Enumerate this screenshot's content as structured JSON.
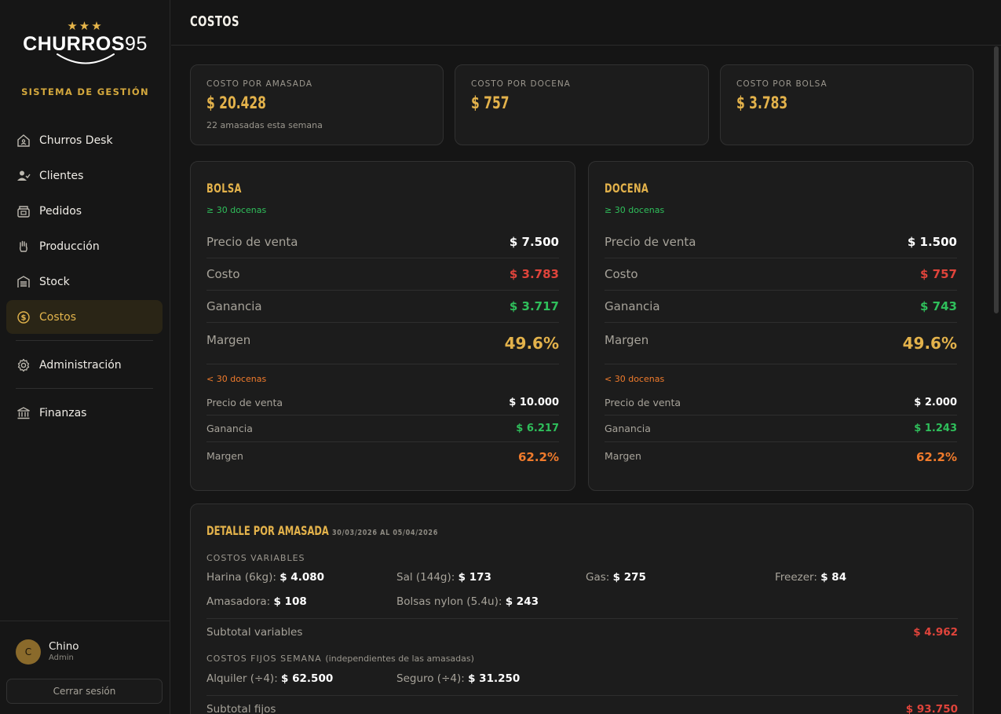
{
  "brand": {
    "stars": "★★★",
    "name": "CHURROS",
    "number": "95",
    "tagline": "SISTEMA DE GESTIÓN"
  },
  "nav": {
    "items": [
      {
        "label": "Churros Desk",
        "icon": "home-icon"
      },
      {
        "label": "Clientes",
        "icon": "user-check-icon"
      },
      {
        "label": "Pedidos",
        "icon": "box-icon"
      },
      {
        "label": "Producción",
        "icon": "hand-icon"
      },
      {
        "label": "Stock",
        "icon": "warehouse-icon"
      },
      {
        "label": "Costos",
        "icon": "dollar-circle-icon",
        "active": true
      },
      {
        "label": "Administración",
        "icon": "gear-icon"
      },
      {
        "label": "Finanzas",
        "icon": "bank-icon"
      }
    ]
  },
  "user": {
    "initial": "C",
    "name": "Chino",
    "role": "Admin",
    "logout_label": "Cerrar sesión"
  },
  "header": {
    "title": "COSTOS"
  },
  "stats": [
    {
      "label": "COSTO POR AMASADA",
      "value": "$ 20.428",
      "sub": "22 amasadas esta semana"
    },
    {
      "label": "COSTO POR DOCENA",
      "value": "$ 757"
    },
    {
      "label": "COSTO POR BOLSA",
      "value": "$ 3.783"
    }
  ],
  "bolsa": {
    "title": "BOLSA",
    "tier_high": "≥ 30 docenas",
    "high": {
      "precio_label": "Precio de venta",
      "precio": "$ 7.500",
      "costo_label": "Costo",
      "costo": "$ 3.783",
      "ganancia_label": "Ganancia",
      "ganancia": "$ 3.717",
      "margen_label": "Margen",
      "margen": "49.6%"
    },
    "tier_low": "< 30 docenas",
    "low": {
      "precio_label": "Precio de venta",
      "precio": "$ 10.000",
      "ganancia_label": "Ganancia",
      "ganancia": "$ 6.217",
      "margen_label": "Margen",
      "margen": "62.2%"
    }
  },
  "docena": {
    "title": "DOCENA",
    "tier_high": "≥ 30 docenas",
    "high": {
      "precio_label": "Precio de venta",
      "precio": "$ 1.500",
      "costo_label": "Costo",
      "costo": "$ 757",
      "ganancia_label": "Ganancia",
      "ganancia": "$ 743",
      "margen_label": "Margen",
      "margen": "49.6%"
    },
    "tier_low": "< 30 docenas",
    "low": {
      "precio_label": "Precio de venta",
      "precio": "$ 2.000",
      "ganancia_label": "Ganancia",
      "ganancia": "$ 1.243",
      "margen_label": "Margen",
      "margen": "62.2%"
    }
  },
  "detalle": {
    "title": "DETALLE POR AMASADA",
    "range": "30/03/2026 AL 05/04/2026",
    "variables_label": "COSTOS VARIABLES",
    "variables": [
      {
        "label": "Harina (6kg):",
        "value": "$ 4.080"
      },
      {
        "label": "Sal (144g):",
        "value": "$ 173"
      },
      {
        "label": "Gas:",
        "value": "$ 275"
      },
      {
        "label": "Freezer:",
        "value": "$ 84"
      },
      {
        "label": "Amasadora:",
        "value": "$ 108"
      },
      {
        "label": "Bolsas nylon (5.4u):",
        "value": "$ 243"
      }
    ],
    "subtotal_variables_label": "Subtotal variables",
    "subtotal_variables": "$ 4.962",
    "fijos_label": "COSTOS FIJOS SEMANA",
    "fijos_note": "(independientes de las amasadas)",
    "fijos": [
      {
        "label": "Alquiler (÷4):",
        "value": "$ 62.500"
      },
      {
        "label": "Seguro (÷4):",
        "value": "$ 31.250"
      }
    ],
    "subtotal_fijos_label": "Subtotal fijos",
    "subtotal_fijos": "$ 93.750"
  }
}
